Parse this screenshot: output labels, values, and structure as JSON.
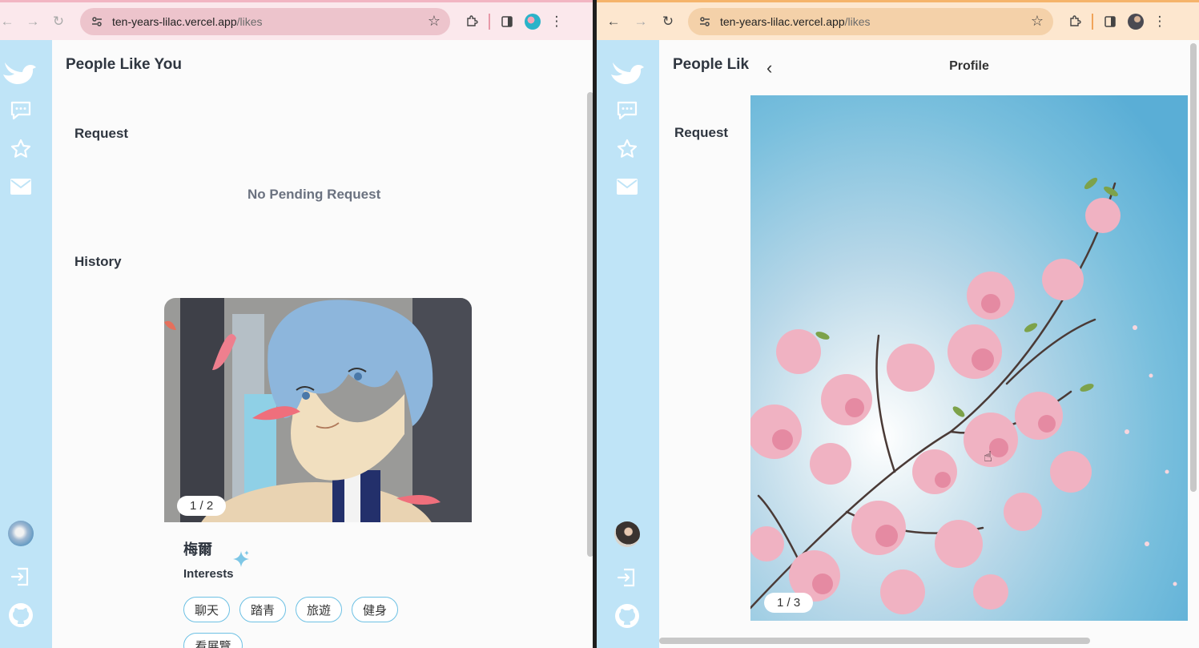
{
  "left": {
    "url_host": "ten-years-lilac.vercel.app",
    "url_path": "/likes",
    "page_title": "People Like You",
    "request_heading": "Request",
    "no_request_text": "No Pending Request",
    "history_heading": "History",
    "card": {
      "pager": "1 / 2",
      "name": "梅爾",
      "interests_heading": "Interests",
      "tags": [
        "聊天",
        "踏青",
        "旅遊",
        "健身",
        "看展覽"
      ]
    }
  },
  "right": {
    "url_host": "ten-years-lilac.vercel.app",
    "url_path": "/likes",
    "page_title": "People Lik",
    "request_heading": "Request",
    "profile_title": "Profile",
    "back_label": "‹",
    "photo_pager": "1 / 3"
  },
  "colors": {
    "sidebar": "#bfe4f7",
    "accent": "#6ec1e4",
    "left_chrome": "#fbe8ec",
    "right_chrome": "#fde7cf"
  },
  "icons": [
    "bird-logo-icon",
    "chat-icon",
    "star-icon",
    "mail-icon",
    "logout-icon",
    "github-icon",
    "avatar"
  ]
}
